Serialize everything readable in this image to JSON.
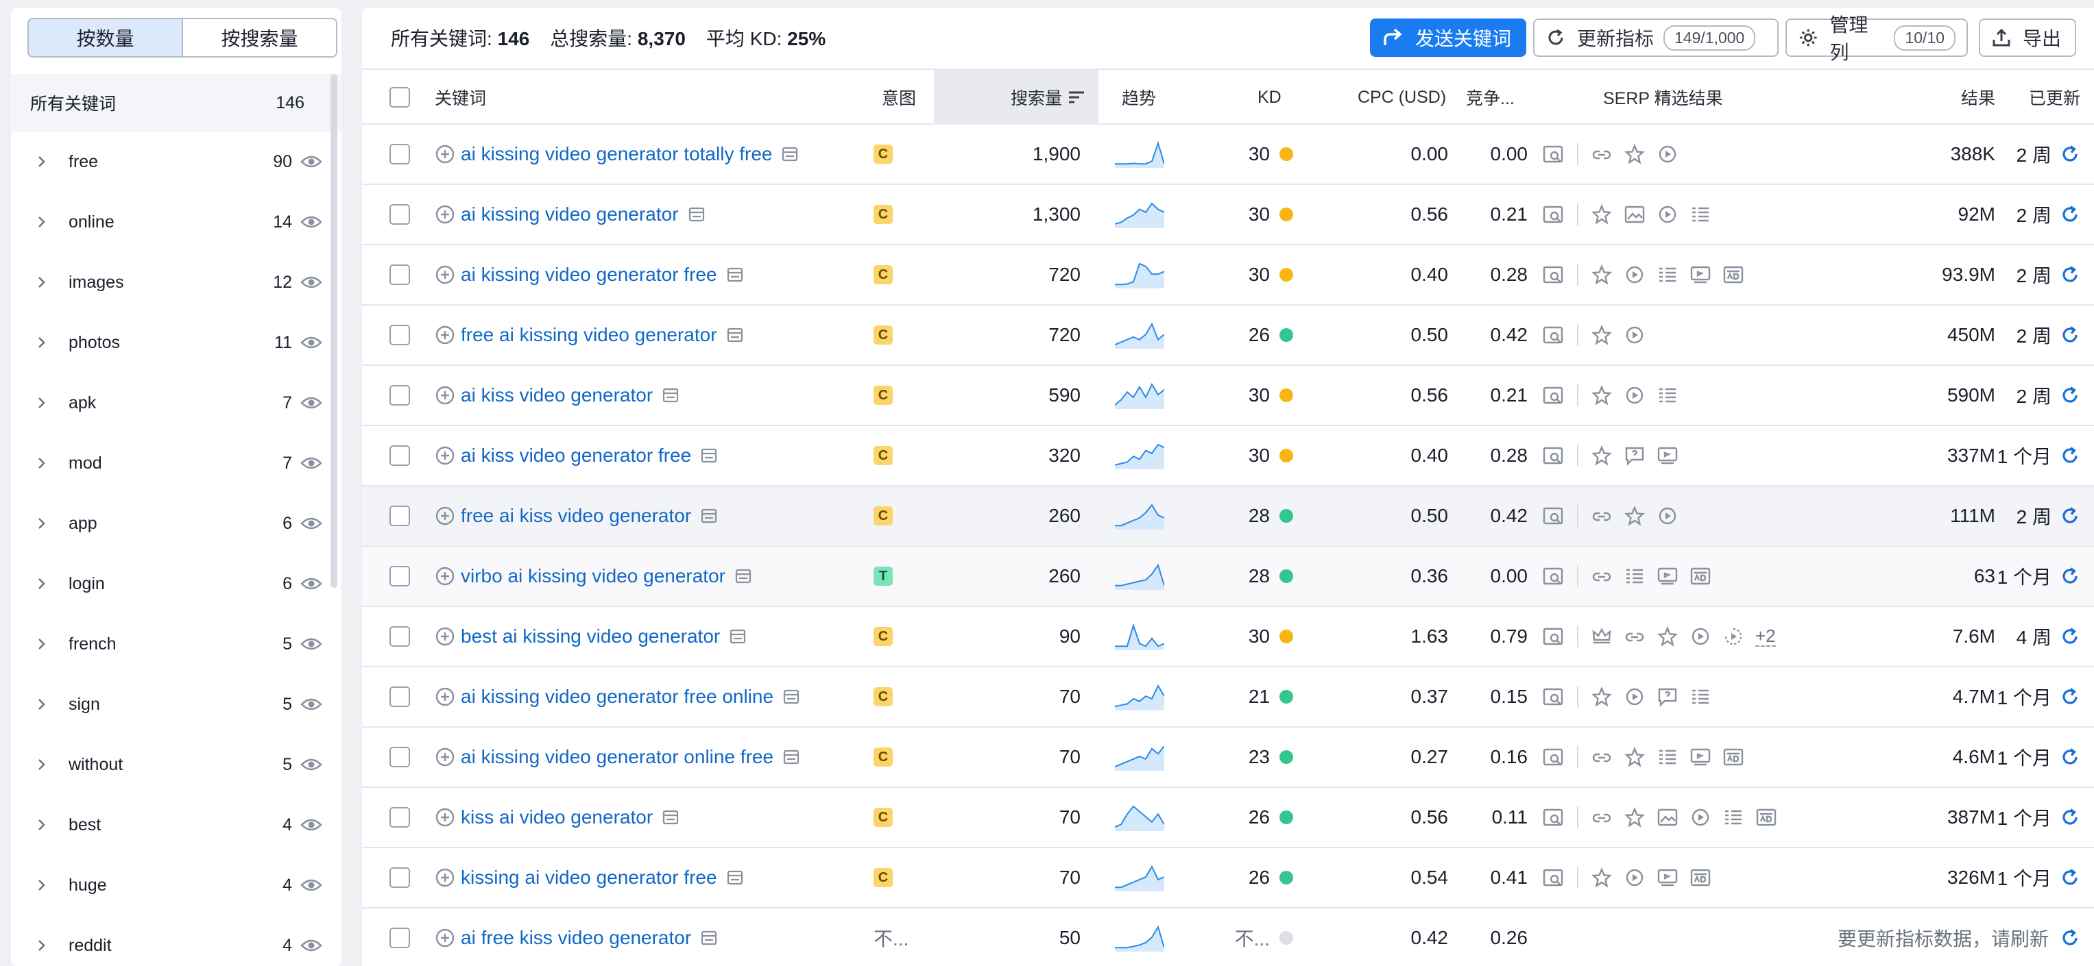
{
  "sidebar": {
    "seg_quantity": "按数量",
    "seg_volume": "按搜索量",
    "all_label": "所有关键词",
    "all_count": "146",
    "items": [
      {
        "label": "free",
        "count": "90"
      },
      {
        "label": "online",
        "count": "14"
      },
      {
        "label": "images",
        "count": "12"
      },
      {
        "label": "photos",
        "count": "11"
      },
      {
        "label": "apk",
        "count": "7"
      },
      {
        "label": "mod",
        "count": "7"
      },
      {
        "label": "app",
        "count": "6"
      },
      {
        "label": "login",
        "count": "6"
      },
      {
        "label": "french",
        "count": "5"
      },
      {
        "label": "sign",
        "count": "5"
      },
      {
        "label": "without",
        "count": "5"
      },
      {
        "label": "best",
        "count": "4"
      },
      {
        "label": "huge",
        "count": "4"
      },
      {
        "label": "reddit",
        "count": "4"
      }
    ]
  },
  "summary": {
    "all_kw_label": "所有关键词:",
    "all_kw_value": "146",
    "volume_label": "总搜索量:",
    "volume_value": "8,370",
    "kd_label": "平均 KD:",
    "kd_value": "25%"
  },
  "toolbar": {
    "send_label": "发送关键词",
    "update_label": "更新指标",
    "update_quota": "149/1,000",
    "manage_label": "管理列",
    "manage_count": "10/10",
    "export_label": "导出"
  },
  "columns": {
    "keyword": "关键词",
    "intent": "意图",
    "volume": "搜索量",
    "trend": "趋势",
    "kd": "KD",
    "cpc": "CPC (USD)",
    "comp": "竞争...",
    "serp": "SERP 精选结果",
    "results": "结果",
    "updated": "已更新"
  },
  "colors": {
    "kd_orange": "#f7b614",
    "kd_green": "#35c690",
    "kd_gray": "#dcdfe5",
    "link": "#1167c7",
    "primary": "#1a7cf0"
  },
  "rows": [
    {
      "keyword": "ai kissing video generator totally free",
      "intent": "C",
      "volume": "1,900",
      "trend": [
        1,
        1,
        1,
        1.2,
        1,
        1,
        2,
        9,
        1
      ],
      "kd": "30",
      "kd_color": "orange",
      "cpc": "0.00",
      "comp": "0.00",
      "serp": [
        "search-box",
        "sep",
        "link",
        "star",
        "play"
      ],
      "results": "388K",
      "updated": "2 周"
    },
    {
      "keyword": "ai kissing video generator",
      "intent": "C",
      "volume": "1,300",
      "trend": [
        1,
        1.5,
        3,
        4,
        6,
        5,
        8,
        6,
        5
      ],
      "kd": "30",
      "kd_color": "orange",
      "cpc": "0.56",
      "comp": "0.21",
      "serp": [
        "search-box",
        "sep",
        "star",
        "image",
        "play",
        "list"
      ],
      "results": "92M",
      "updated": "2 周"
    },
    {
      "keyword": "ai kissing video generator free",
      "intent": "C",
      "volume": "720",
      "trend": [
        1,
        1,
        1.2,
        2,
        9,
        8,
        5,
        5,
        6
      ],
      "kd": "30",
      "kd_color": "orange",
      "cpc": "0.40",
      "comp": "0.28",
      "serp": [
        "search-box",
        "sep",
        "star",
        "play",
        "list",
        "video",
        "ad"
      ],
      "results": "93.9M",
      "updated": "2 周"
    },
    {
      "keyword": "free ai kissing video generator",
      "intent": "C",
      "volume": "720",
      "trend": [
        1,
        2,
        3,
        4,
        3,
        5,
        9,
        3,
        5
      ],
      "kd": "26",
      "kd_color": "green",
      "cpc": "0.50",
      "comp": "0.42",
      "serp": [
        "search-box",
        "sep",
        "star",
        "play"
      ],
      "results": "450M",
      "updated": "2 周"
    },
    {
      "keyword": "ai kiss video generator",
      "intent": "C",
      "volume": "590",
      "trend": [
        1,
        3,
        6,
        4,
        8,
        4,
        9,
        5,
        7
      ],
      "kd": "30",
      "kd_color": "orange",
      "cpc": "0.56",
      "comp": "0.21",
      "serp": [
        "search-box",
        "sep",
        "star",
        "play",
        "list"
      ],
      "results": "590M",
      "updated": "2 周"
    },
    {
      "keyword": "ai kiss video generator free",
      "intent": "C",
      "volume": "320",
      "trend": [
        1,
        1.5,
        2,
        4,
        3,
        6,
        5,
        8,
        7
      ],
      "kd": "30",
      "kd_color": "orange",
      "cpc": "0.40",
      "comp": "0.28",
      "serp": [
        "search-box",
        "sep",
        "star",
        "faq",
        "video"
      ],
      "results": "337M",
      "updated": "1 个月"
    },
    {
      "keyword": "free ai kiss video generator",
      "intent": "C",
      "volume": "260",
      "trend": [
        1,
        1,
        2,
        3,
        4,
        6,
        9,
        5,
        4
      ],
      "kd": "28",
      "kd_color": "green",
      "cpc": "0.50",
      "comp": "0.42",
      "serp": [
        "search-box",
        "sep",
        "link",
        "star",
        "play"
      ],
      "results": "111M",
      "updated": "2 周"
    },
    {
      "keyword": "virbo ai kissing video generator",
      "intent": "T",
      "volume": "260",
      "trend": [
        1,
        1,
        1.5,
        2,
        2.5,
        3,
        5,
        8,
        1
      ],
      "kd": "28",
      "kd_color": "green",
      "cpc": "0.36",
      "comp": "0.00",
      "serp": [
        "search-box",
        "sep",
        "link",
        "list",
        "video",
        "ad"
      ],
      "results": "63",
      "updated": "1 个月"
    },
    {
      "keyword": "best ai kissing video generator",
      "intent": "C",
      "volume": "90",
      "trend": [
        1,
        1,
        1,
        9,
        2,
        1,
        4,
        1,
        2
      ],
      "kd": "30",
      "kd_color": "orange",
      "cpc": "1.63",
      "comp": "0.79",
      "serp": [
        "search-box",
        "sep",
        "crown",
        "link",
        "star",
        "play",
        "clock-play"
      ],
      "serp_more": "+2",
      "results": "7.6M",
      "updated": "4 周"
    },
    {
      "keyword": "ai kissing video generator free online",
      "intent": "C",
      "volume": "70",
      "trend": [
        1,
        1.5,
        2,
        4,
        3,
        5,
        4,
        9,
        5
      ],
      "kd": "21",
      "kd_color": "green",
      "cpc": "0.37",
      "comp": "0.15",
      "serp": [
        "search-box",
        "sep",
        "star",
        "play",
        "faq",
        "list"
      ],
      "results": "4.7M",
      "updated": "1 个月"
    },
    {
      "keyword": "ai kissing video generator online free",
      "intent": "C",
      "volume": "70",
      "trend": [
        1,
        2,
        3,
        4,
        5,
        4,
        8,
        6,
        9
      ],
      "kd": "23",
      "kd_color": "green",
      "cpc": "0.27",
      "comp": "0.16",
      "serp": [
        "search-box",
        "sep",
        "link",
        "star",
        "list",
        "video",
        "ad"
      ],
      "results": "4.6M",
      "updated": "1 个月"
    },
    {
      "keyword": "kiss ai video generator",
      "intent": "C",
      "volume": "70",
      "trend": [
        1,
        2,
        6,
        9,
        7,
        5,
        3,
        6,
        2
      ],
      "kd": "26",
      "kd_color": "green",
      "cpc": "0.56",
      "comp": "0.11",
      "serp": [
        "search-box",
        "sep",
        "link",
        "star",
        "image",
        "play",
        "list",
        "ad"
      ],
      "results": "387M",
      "updated": "1 个月"
    },
    {
      "keyword": "kissing ai video generator free",
      "intent": "C",
      "volume": "70",
      "trend": [
        1,
        1,
        2,
        3,
        4,
        5,
        9,
        4,
        5
      ],
      "kd": "26",
      "kd_color": "green",
      "cpc": "0.54",
      "comp": "0.41",
      "serp": [
        "search-box",
        "sep",
        "star",
        "play",
        "video",
        "ad"
      ],
      "results": "326M",
      "updated": "1 个月"
    },
    {
      "keyword": "ai free kiss video generator",
      "intent": "不...",
      "volume": "50",
      "trend": [
        1,
        1,
        1,
        1.5,
        2,
        3,
        5,
        9,
        1
      ],
      "kd": "不...",
      "kd_color": "gray",
      "cpc": "0.42",
      "comp": "0.26",
      "serp": [],
      "results": "",
      "updated": "",
      "notice": "要更新指标数据，请刷新"
    }
  ]
}
